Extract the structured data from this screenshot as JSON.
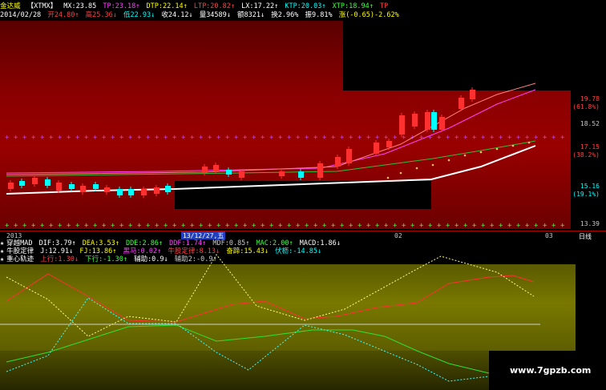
{
  "header": {
    "stock_name": "金达威",
    "indicator_name": "【XTMX】",
    "line1": [
      {
        "label": "MX:23.85",
        "color": "#ffffff"
      },
      {
        "label": "TP:23.18↑",
        "color": "#ff40ff"
      },
      {
        "label": "DTP:22.14↑",
        "color": "#ffff00"
      },
      {
        "label": "LTP:20.82↑",
        "color": "#ff4040"
      },
      {
        "label": "LX:17.22↑",
        "color": "#ffffff"
      },
      {
        "label": "KTP:20.03↑",
        "color": "#00ffff"
      },
      {
        "label": "XTP:18.94↑",
        "color": "#40ff40"
      },
      {
        "label": "TP",
        "color": "#ff4040"
      }
    ],
    "date": "2014/02/28",
    "line2": [
      {
        "label": "开24.80↑",
        "color": "#ff4040"
      },
      {
        "label": "高25.36↓",
        "color": "#ff4040"
      },
      {
        "label": "低22.93↓",
        "color": "#00ffff"
      },
      {
        "label": "收24.12↓",
        "color": "#ffffff"
      },
      {
        "label": "量34589↓",
        "color": "#ffffff"
      },
      {
        "label": "额8321↓",
        "color": "#ffffff"
      },
      {
        "label": "换2.96%",
        "color": "#ffffff"
      },
      {
        "label": "振9.81%",
        "color": "#ffffff"
      },
      {
        "label": "涨(-0.65)-2.62%",
        "color": "#ffff00"
      }
    ]
  },
  "price_axis": {
    "labels": [
      {
        "text": "19.78",
        "color": "#ff4040"
      },
      {
        "text": "(61.8%)",
        "color": "#ff4040"
      },
      {
        "text": "18.52",
        "color": "#c8c8c8"
      },
      {
        "text": "17.15",
        "color": "#ff4040"
      },
      {
        "text": "(38.2%)",
        "color": "#ff4040"
      },
      {
        "text": "15.16",
        "color": "#00ffff"
      },
      {
        "text": "(19.1%)",
        "color": "#00ffff"
      },
      {
        "text": "13.39",
        "color": "#c8c8c8"
      }
    ]
  },
  "time_axis": {
    "labels": [
      "2013",
      "13/12/27,五",
      "02",
      "03"
    ],
    "period": "日线"
  },
  "indicator_rows": [
    {
      "star": "★",
      "name": "穿越MAD",
      "items": [
        {
          "label": "DIF:3.79↑",
          "color": "#ffffff"
        },
        {
          "label": "DEA:3.53↑",
          "color": "#ffff00"
        },
        {
          "label": "DDE:2.86↑",
          "color": "#40ff40"
        },
        {
          "label": "DDF:1.74↑",
          "color": "#ff40ff"
        },
        {
          "label": "MDF:0.85↑",
          "color": "#c8c8c8"
        },
        {
          "label": "MAC:2.00↑",
          "color": "#40ff40"
        },
        {
          "label": "MACD:1.86↓",
          "color": "#ffffff"
        }
      ]
    },
    {
      "star": "★",
      "name": "牛股定律",
      "items": [
        {
          "label": "J:12.91↓",
          "color": "#ffffff"
        },
        {
          "label": "FJ:13.86↑",
          "color": "#ffff00"
        },
        {
          "label": "黑马:0.02↑",
          "color": "#ff40ff"
        },
        {
          "label": "牛股定律:8.13↓",
          "color": "#ff4040"
        },
        {
          "label": "奋蹄:15.43↓",
          "color": "#ffff00"
        },
        {
          "label": "伏枥:-14.85↓",
          "color": "#00ffff"
        }
      ]
    },
    {
      "star": "★",
      "name": "重心轨迹",
      "items": [
        {
          "label": "上行:1.30↓",
          "color": "#ff4040"
        },
        {
          "label": "下行:-1.30↑",
          "color": "#40ff40"
        },
        {
          "label": "辅助:0.9↓",
          "color": "#ffffff"
        },
        {
          "label": "辅助2:-0.9↑",
          "color": "#c8c8c8"
        }
      ]
    }
  ],
  "lower_axis": {
    "labels": [
      {
        "text": "1.00",
        "color": "#ffffff"
      },
      {
        "text": "0.00",
        "color": "#ffffff"
      }
    ]
  },
  "watermark": "www.7gpzb.com",
  "colors": {
    "up_candle": "#ff3030",
    "down_candle": "#00ffff",
    "dots_purple": "#c040ff",
    "dots_green": "#30ff30"
  }
}
